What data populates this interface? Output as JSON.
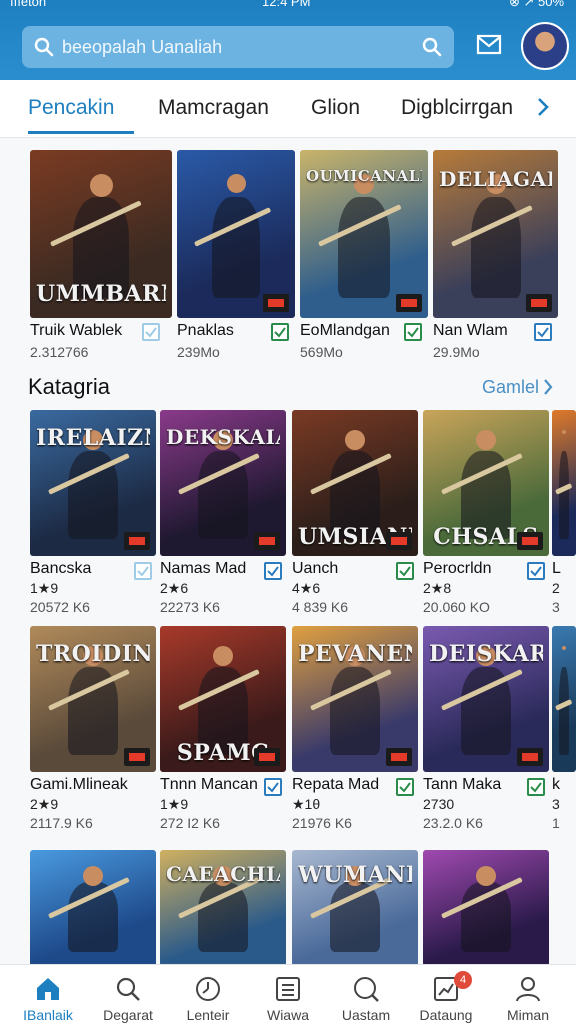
{
  "status_bar": {
    "carrier": "ıııeton",
    "time": "12:4 PM",
    "battery": "⊗ ↗ 50%"
  },
  "search": {
    "text": "beeopalah Uanaliah"
  },
  "tabs": [
    {
      "label": "Pencakin",
      "active": true
    },
    {
      "label": "Mamcragan",
      "active": false
    },
    {
      "label": "Glion",
      "active": false
    },
    {
      "label": "Digblcirrgan",
      "active": false
    }
  ],
  "top_row": [
    {
      "name": "Truik Wablek",
      "size": "2.312766",
      "art_title": "UMMBARN",
      "colors": [
        "#3a2a22",
        "#7b3b22"
      ],
      "check": "light"
    },
    {
      "name": "Pnaklas",
      "size": "239Mo",
      "art_title": "",
      "colors": [
        "#1b2a5a",
        "#2a5aa8"
      ],
      "check": "green"
    },
    {
      "name": "EoMlandgan",
      "size": "569Mo",
      "art_title": "OUMICANALIGE",
      "colors": [
        "#2f5e8c",
        "#c9b46a"
      ],
      "check": "green"
    },
    {
      "name": "Nan Wlam",
      "size": "29.9Mo",
      "art_title": "DELIAGAIN",
      "colors": [
        "#3a3f5a",
        "#b77b3a"
      ],
      "check": "blue"
    }
  ],
  "section": {
    "title": "Katagria",
    "link": "Gamlel"
  },
  "grid_row_1": [
    {
      "name": "Bancska",
      "rating": "1★9",
      "size": "20572 K6",
      "art_title": "IRELAIZN",
      "colors": [
        "#1c2a44",
        "#3a6aa0"
      ],
      "check": "light"
    },
    {
      "name": "Namas Mad",
      "rating": "2★6",
      "size": "22273 K6",
      "art_title": "DEKSKAIAN",
      "colors": [
        "#1e1830",
        "#8a3a8a"
      ],
      "check": "blue"
    },
    {
      "name": "Uanch",
      "rating": "4★6",
      "size": "4 839 K6",
      "art_title": "UMSIANEN",
      "colors": [
        "#2b1e1a",
        "#7a3a24"
      ],
      "check": "green"
    },
    {
      "name": "Perocrldn",
      "rating": "2★8",
      "size": "20.060 KO",
      "art_title": "CHSALS",
      "colors": [
        "#4a6a3a",
        "#c9a45a"
      ],
      "check": "blue"
    },
    {
      "name": "L",
      "rating": "2",
      "size": "3",
      "art_title": "",
      "colors": [
        "#1b2a5a",
        "#e07a2a"
      ],
      "check": "none"
    }
  ],
  "grid_row_2": [
    {
      "name": "Gami.Mlineak",
      "rating": "2★9",
      "size": "2117.9 K6",
      "art_title": "TROIDIN",
      "colors": [
        "#5a4a3a",
        "#b08a5a"
      ],
      "check": "none"
    },
    {
      "name": "Tnnn Mancan",
      "rating": "1★9",
      "size": "272 I2 K6",
      "art_title": "SPAMC",
      "colors": [
        "#3a1a1a",
        "#a83a2a"
      ],
      "check": "blue"
    },
    {
      "name": "Repata Mad",
      "rating": "★1θ",
      "size": "21976 K6",
      "art_title": "PEVANEN",
      "colors": [
        "#3a3a6a",
        "#e0a040"
      ],
      "check": "green"
    },
    {
      "name": "Tann Maka",
      "rating": "2730",
      "size": "23.2.0 K6",
      "art_title": "DEISKARN",
      "colors": [
        "#2a2a5a",
        "#7a5ab0"
      ],
      "check": "green"
    },
    {
      "name": "k",
      "rating": "3",
      "size": "1",
      "art_title": "",
      "colors": [
        "#1a3a5a",
        "#3a7ab0"
      ],
      "check": "none"
    }
  ],
  "grid_row_3": [
    {
      "art_title": "",
      "colors": [
        "#1e4a8a",
        "#4a9ae0"
      ]
    },
    {
      "art_title": "CAEACHIAN",
      "colors": [
        "#2a5a8a",
        "#d0b060"
      ]
    },
    {
      "art_title": "WUMANIAN",
      "colors": [
        "#4a6a9a",
        "#a8b8d0"
      ]
    },
    {
      "art_title": "",
      "colors": [
        "#2a1a4a",
        "#a04ab0"
      ]
    }
  ],
  "bottom_nav": [
    {
      "label": "IBanlaik",
      "icon": "home-icon",
      "active": true
    },
    {
      "label": "Degarat",
      "icon": "search-icon",
      "active": false
    },
    {
      "label": "Lenteir",
      "icon": "compass-icon",
      "active": false
    },
    {
      "label": "Wiawa",
      "icon": "list-icon",
      "active": false
    },
    {
      "label": "Uastam",
      "icon": "search-circle-icon",
      "active": false
    },
    {
      "label": "Dataung",
      "icon": "chart-icon",
      "active": false,
      "badge": "4"
    },
    {
      "label": "Miman",
      "icon": "person-icon",
      "active": false
    }
  ],
  "colors": {
    "accent": "#1d7fc0",
    "header": "#2b8fcf",
    "check_green": "#2a8c4a",
    "check_blue": "#2b7bbf"
  }
}
